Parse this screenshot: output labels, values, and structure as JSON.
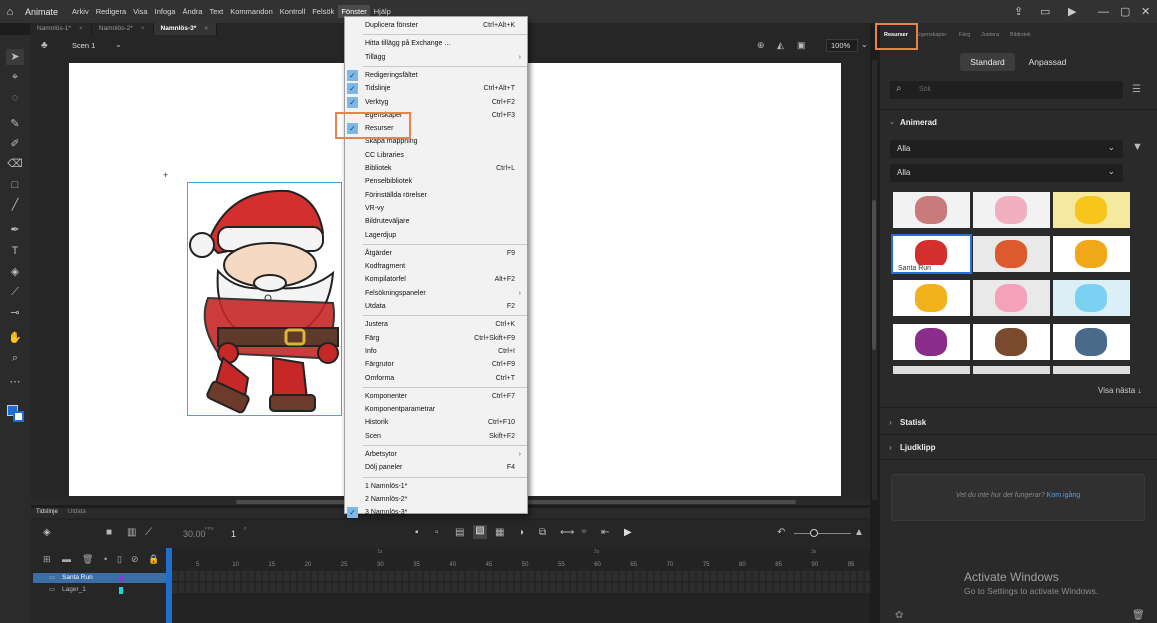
{
  "app": {
    "name": "Animate"
  },
  "menubar": {
    "items": [
      "Arkiv",
      "Redigera",
      "Visa",
      "Infoga",
      "Ändra",
      "Text",
      "Kommandon",
      "Kontroll",
      "Felsök",
      "Fönster",
      "Hjälp"
    ],
    "active": "Fönster"
  },
  "doc_tabs": [
    {
      "label": "Namnlös-1*"
    },
    {
      "label": "Namnlös-2*"
    },
    {
      "label": "Namnlös-3*",
      "active": true
    }
  ],
  "scene": {
    "label": "Scen 1",
    "zoom": "100%"
  },
  "window_menu": {
    "groups": [
      [
        {
          "label": "Duplicera fönster",
          "shortcut": "Ctrl+Alt+K"
        }
      ],
      [
        {
          "label": "Hitta tillägg på Exchange ..."
        },
        {
          "label": "Tillägg",
          "submenu": true
        }
      ],
      [
        {
          "label": "Redigeringsfältet",
          "checked": true
        },
        {
          "label": "Tidslinje",
          "shortcut": "Ctrl+Alt+T",
          "checked": true
        },
        {
          "label": "Verktyg",
          "shortcut": "Ctrl+F2",
          "checked": true
        },
        {
          "label": "Egenskaper",
          "shortcut": "Ctrl+F3"
        },
        {
          "label": "Resurser",
          "checked": true
        },
        {
          "label": "Skapa mappning"
        },
        {
          "label": "CC Libraries"
        },
        {
          "label": "Bibliotek",
          "shortcut": "Ctrl+L"
        },
        {
          "label": "Penselbibliotek"
        },
        {
          "label": "Förinställda rörelser"
        },
        {
          "label": "VR-vy"
        },
        {
          "label": "Bildruteväljare"
        },
        {
          "label": "Lagerdjup"
        }
      ],
      [
        {
          "label": "Åtgärder",
          "shortcut": "F9"
        },
        {
          "label": "Kodfragment"
        },
        {
          "label": "Kompilatorfel",
          "shortcut": "Alt+F2"
        },
        {
          "label": "Felsökningspaneler",
          "submenu": true
        },
        {
          "label": "Utdata",
          "shortcut": "F2"
        }
      ],
      [
        {
          "label": "Justera",
          "shortcut": "Ctrl+K"
        },
        {
          "label": "Färg",
          "shortcut": "Ctrl+Skift+F9"
        },
        {
          "label": "Info",
          "shortcut": "Ctrl+I"
        },
        {
          "label": "Färgrutor",
          "shortcut": "Ctrl+F9"
        },
        {
          "label": "Omforma",
          "shortcut": "Ctrl+T"
        }
      ],
      [
        {
          "label": "Komponenter",
          "shortcut": "Ctrl+F7"
        },
        {
          "label": "Komponentparametrar"
        },
        {
          "label": "Historik",
          "shortcut": "Ctrl+F10"
        },
        {
          "label": "Scen",
          "shortcut": "Skift+F2"
        }
      ],
      [
        {
          "label": "Arbetsytor",
          "submenu": true
        },
        {
          "label": "Dölj paneler",
          "shortcut": "F4"
        }
      ],
      [
        {
          "label": "1 Namnlös-1*"
        },
        {
          "label": "2 Namnlös-2*"
        },
        {
          "label": "3 Namnlös-3*",
          "checked": true
        }
      ]
    ]
  },
  "timeline": {
    "tabs": [
      "Tidslinje",
      "Utdata"
    ],
    "fps": "30.00",
    "fps_unit": "FPS",
    "frame": "1",
    "frame_unit": "F",
    "seconds": [
      "1s",
      "2s",
      "3s"
    ],
    "ruler": [
      "5",
      "10",
      "15",
      "20",
      "25",
      "30",
      "35",
      "40",
      "45",
      "50",
      "55",
      "60",
      "65",
      "70",
      "75",
      "80",
      "85",
      "90",
      "95"
    ],
    "layers": [
      {
        "name": "Santa Run",
        "color": "#8a3cc8",
        "selected": true
      },
      {
        "name": "Lager_1",
        "color": "#1ad6d6"
      }
    ]
  },
  "right_panel": {
    "tabs": [
      "Resurser",
      "Egenskaper",
      "Färg",
      "Justera",
      "Bibliotek"
    ],
    "active_tab": "Resurser",
    "segment": [
      "Standard",
      "Anpassad"
    ],
    "search_placeholder": "Sök",
    "section_animated": "Animerad",
    "filter1": "Alla",
    "filter2": "Alla",
    "selected_asset_label": "Santa Run",
    "show_next": "Visa nästa",
    "section_static": "Statisk",
    "section_sound": "Ljudklipp",
    "help_text": "Vet du inte hur det fungerar?",
    "help_link": "Kom igång"
  },
  "watermark": {
    "title": "Activate Windows",
    "subtitle": "Go to Settings to activate Windows."
  },
  "colors": {
    "highlight": "#e8834a",
    "selection": "#3a6ea5",
    "stage": "#ffffff"
  }
}
